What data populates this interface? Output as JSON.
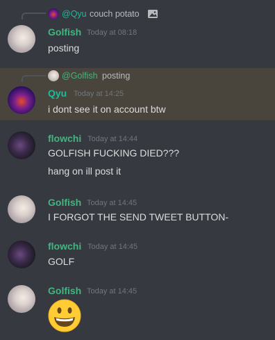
{
  "colors": {
    "background": "#36393f",
    "highlight": "#49443c",
    "golfish": "#43b581",
    "qyu": "#1abc9c",
    "flowchi": "#43b581",
    "timestamp": "#72767d",
    "text": "#dcddde"
  },
  "messages": [
    {
      "reply": {
        "author": "@Qyu",
        "text": "couch potato",
        "icon": "image-icon"
      },
      "author": "Golfish",
      "timestamp": "Today at 08:18",
      "lines": [
        "posting"
      ]
    },
    {
      "reply": {
        "author": "@Golfish",
        "text": "posting"
      },
      "author": "Qyu",
      "timestamp": "Today at 14:25",
      "lines": [
        "i dont see it on account btw"
      ]
    },
    {
      "author": "flowchi",
      "timestamp": "Today at 14:44",
      "lines": [
        "GOLFISH FUCKING DIED???",
        "hang on ill post it"
      ]
    },
    {
      "author": "Golfish",
      "timestamp": "Today at 14:45",
      "lines": [
        "I FORGOT THE SEND TWEET BUTTON-"
      ]
    },
    {
      "author": "flowchi",
      "timestamp": "Today at 14:45",
      "lines": [
        "GOLF"
      ]
    },
    {
      "author": "Golfish",
      "timestamp": "Today at 14:45",
      "emoji": "grinning-face-emoji"
    }
  ]
}
